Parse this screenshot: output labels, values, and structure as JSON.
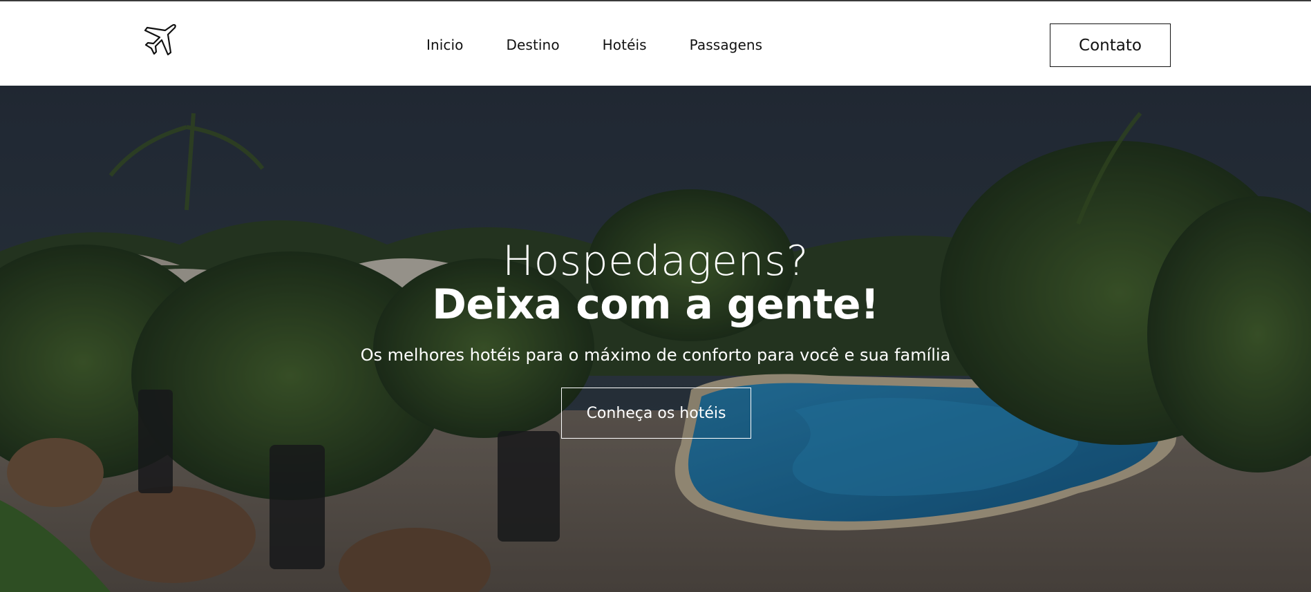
{
  "header": {
    "logo_icon": "airplane-icon",
    "nav": [
      {
        "label": "Inicio"
      },
      {
        "label": "Destino"
      },
      {
        "label": "Hotéis"
      },
      {
        "label": "Passagens"
      }
    ],
    "contact_label": "Contato"
  },
  "hero": {
    "title_light": "Hospedagens?",
    "title_bold": "Deixa com a gente!",
    "subtitle": "Os melhores hotéis para o máximo de conforto para você e sua família",
    "cta_label": "Conheça os hotéis",
    "background": "resort-pool-with-palm-trees-photo"
  },
  "colors": {
    "text_dark": "#111111",
    "header_bg": "#ffffff",
    "hero_text": "#ffffff",
    "pool_blue": "#1e7fb0",
    "sky_dark": "#23303d"
  }
}
